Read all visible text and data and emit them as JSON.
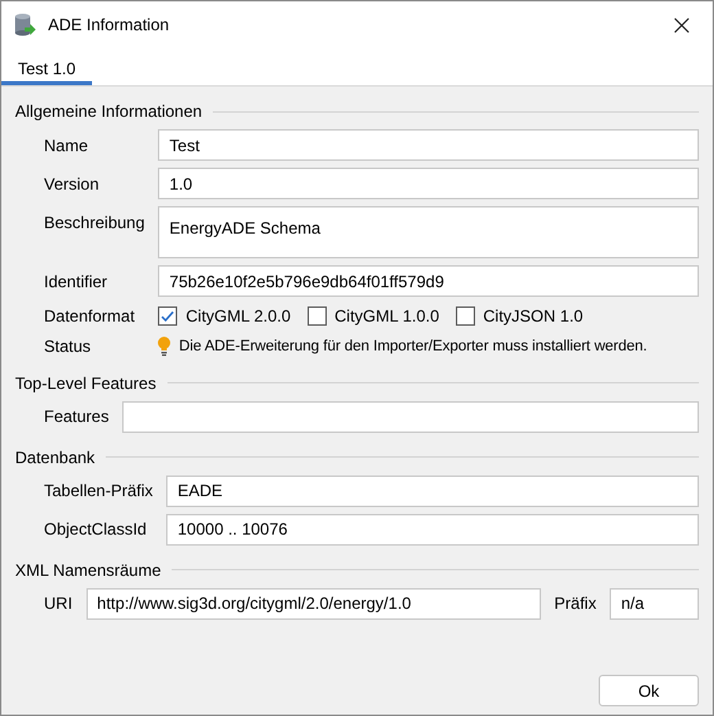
{
  "window": {
    "title": "ADE Information"
  },
  "tabs": [
    {
      "label": "Test 1.0",
      "selected": true
    }
  ],
  "sections": [
    {
      "title": "Allgemeine Informationen",
      "rows": [
        {
          "kind": "field",
          "label": "Name",
          "value": "Test"
        },
        {
          "kind": "field",
          "label": "Version",
          "value": "1.0"
        },
        {
          "kind": "textarea",
          "label": "Beschreibung",
          "value": "EnergyADE Schema"
        },
        {
          "kind": "field",
          "label": "Identifier",
          "value": "75b26e10f2e5b796e9db64f01ff579d9"
        },
        {
          "kind": "checkboxes",
          "label": "Datenformat",
          "options": [
            {
              "label": "CityGML 2.0.0",
              "checked": true
            },
            {
              "label": "CityGML 1.0.0",
              "checked": false
            },
            {
              "label": "CityJSON 1.0",
              "checked": false
            }
          ]
        },
        {
          "kind": "status",
          "label": "Status",
          "value": "Die ADE-Erweiterung für den Importer/Exporter muss installiert werden."
        }
      ]
    },
    {
      "title": "Top-Level Features",
      "rows": [
        {
          "kind": "field",
          "label": "Features",
          "value": ""
        }
      ]
    },
    {
      "title": "Datenbank",
      "rows": [
        {
          "kind": "field",
          "label": "Tabellen-Präfix",
          "value": "EADE"
        },
        {
          "kind": "field",
          "label": "ObjectClassId",
          "value": "10000 .. 10076"
        }
      ]
    },
    {
      "title": "XML Namensräume",
      "rows": [
        {
          "kind": "namespace",
          "label": "URI",
          "value": "http://www.sig3d.org/citygml/2.0/energy/1.0",
          "prefix_label": "Präfix",
          "prefix_value": "n/a"
        }
      ]
    }
  ],
  "buttons": [
    "Ok"
  ]
}
